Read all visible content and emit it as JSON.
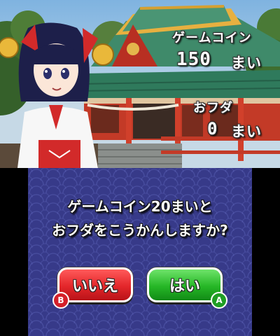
{
  "top_screen": {
    "coins": {
      "label": "ゲームコイン",
      "value": "150",
      "unit": "まい"
    },
    "fuda": {
      "label": "おフダ",
      "value": "0",
      "unit": "まい"
    }
  },
  "bottom_screen": {
    "prompt_line1": "ゲームコイン20まいと",
    "prompt_line2": "おフダをこうかんしますか?",
    "buttons": {
      "no": {
        "label": "いいえ",
        "key": "B"
      },
      "yes": {
        "label": "はい",
        "key": "A"
      }
    }
  },
  "colors": {
    "no_button": "#e3262a",
    "yes_button": "#26b726",
    "panel_bg": "#373a89"
  }
}
